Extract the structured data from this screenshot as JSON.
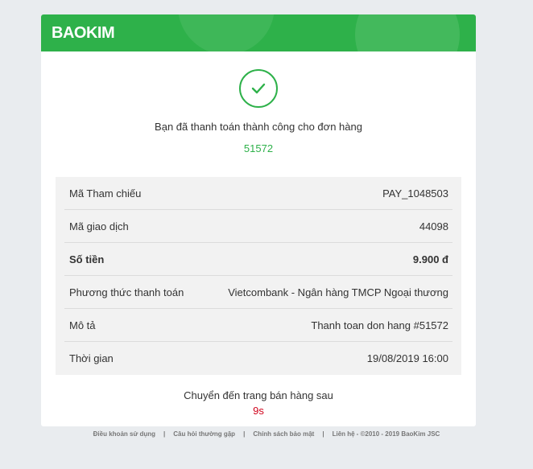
{
  "header": {
    "logo_text": "BAOKIM",
    "brand_color": "#2eb14a"
  },
  "status": {
    "icon": "check-circle-icon",
    "message": "Bạn đã thanh toán thành công cho đơn hàng",
    "order_id": "51572"
  },
  "details": [
    {
      "label": "Mã Tham chiếu",
      "value": "PAY_1048503"
    },
    {
      "label": "Mã giao dịch",
      "value": "44098"
    },
    {
      "label": "Số tiền",
      "value": "9.900 đ"
    },
    {
      "label": "Phương thức thanh toán",
      "value": "Vietcombank - Ngân hàng TMCP Ngoại thương"
    },
    {
      "label": "Mô tả",
      "value": "Thanh toan don hang #51572"
    },
    {
      "label": "Thời gian",
      "value": "19/08/2019 16:00"
    }
  ],
  "redirect": {
    "text": "Chuyển đến trang bán hàng sau",
    "countdown": "9s",
    "countdown_color": "#d0021b"
  },
  "footer": {
    "links": [
      "Điều khoản sử dụng",
      "Câu hỏi thường gặp",
      "Chính sách bảo mật",
      "Liên hệ"
    ],
    "separator": "|",
    "copyright": "- ©2010 - 2019 BaoKim JSC"
  }
}
